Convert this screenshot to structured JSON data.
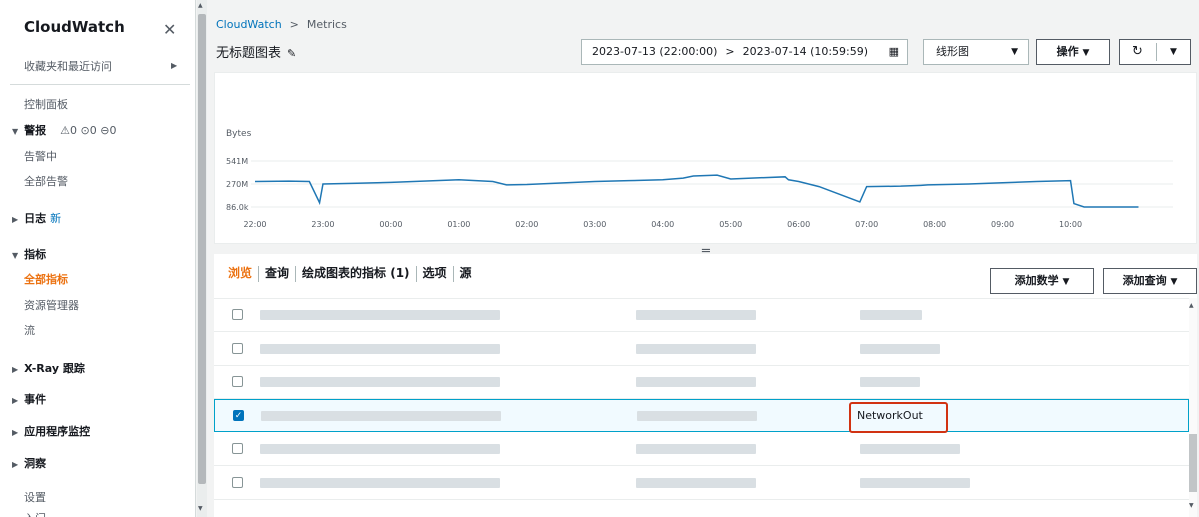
{
  "sidebar": {
    "title": "CloudWatch",
    "favorites": "收藏夹和最近访问",
    "dashboards": "控制面板",
    "alarms": {
      "label": "警报",
      "counts": "⚠0 ⊙0 ⊖0",
      "in_alarm": "告警中",
      "all_alarms": "全部告警"
    },
    "logs": {
      "label": "日志",
      "badge": "新"
    },
    "metrics": {
      "label": "指标",
      "all": "全部指标",
      "explorer": "资源管理器",
      "streams": "流"
    },
    "xray": "X-Ray 跟踪",
    "events": "事件",
    "app_monitoring": "应用程序监控",
    "insights": "洞察",
    "settings": "设置",
    "getting_started": "入门"
  },
  "breadcrumb": {
    "root": "CloudWatch",
    "current": "Metrics"
  },
  "graph_title": "无标题图表",
  "time_range": {
    "start": "2023-07-13 (22:00:00)",
    "end": "2023-07-14 (10:59:59)"
  },
  "chart_type_select": "线形图",
  "actions_label": "操作",
  "chart_data": {
    "type": "line",
    "ylabel": "Bytes",
    "y_ticks": [
      "541M",
      "270M",
      "86.0k"
    ],
    "x_ticks": [
      "22:00",
      "23:00",
      "00:00",
      "01:00",
      "02:00",
      "03:00",
      "04:00",
      "05:00",
      "06:00",
      "07:00",
      "08:00",
      "09:00",
      "10:00"
    ],
    "series": [
      {
        "color": "#1f77b4",
        "x": [
          0,
          0.5,
          0.8,
          0.95,
          1.0,
          1.5,
          2,
          3,
          3.5,
          3.7,
          4,
          5,
          5.5,
          6,
          6.3,
          6.45,
          6.8,
          7,
          7.8,
          7.85,
          8,
          8.3,
          8.9,
          9.0,
          9.5,
          9.8,
          9.9,
          10.5,
          11,
          11.5,
          12,
          12.05,
          12.2,
          13
        ],
        "y": [
          300,
          305,
          300,
          50,
          270,
          280,
          290,
          320,
          300,
          260,
          265,
          300,
          310,
          320,
          340,
          365,
          375,
          330,
          355,
          320,
          300,
          240,
          60,
          240,
          245,
          255,
          260,
          270,
          285,
          300,
          310,
          40,
          0.086,
          0.086
        ]
      }
    ]
  },
  "tabs": [
    "浏览",
    "查询",
    "绘成图表的指标 (1)",
    "选项",
    "源"
  ],
  "add_math": "添加数学",
  "add_query": "添加查询",
  "selected_metric": "NetworkOut"
}
